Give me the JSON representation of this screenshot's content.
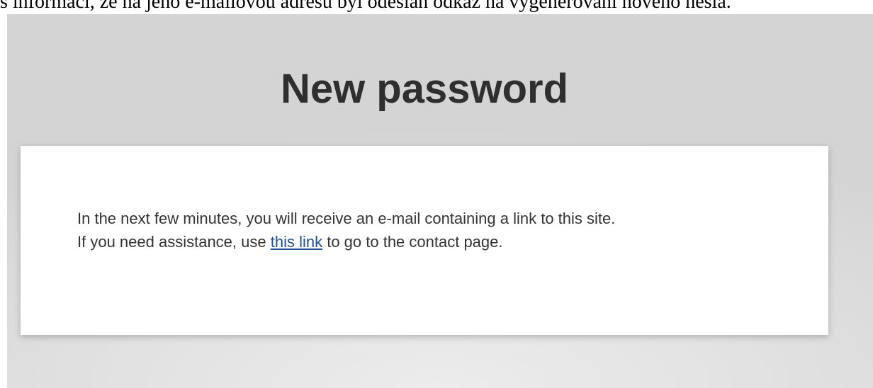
{
  "document": {
    "caption": "s informací, že na jeho e-mailovou adresu byl odeslán odkaz na vygenerování nového hesla."
  },
  "page": {
    "title": "New password"
  },
  "message": {
    "line1": "In the next few minutes, you will receive an e-mail containing a link to this site.",
    "line2_before": "If you need assistance, use ",
    "line2_link": "this link",
    "line2_after": " to go to the contact page."
  },
  "colors": {
    "link": "#1f4e96",
    "title": "#2f2f2f",
    "body_text": "#333333"
  }
}
